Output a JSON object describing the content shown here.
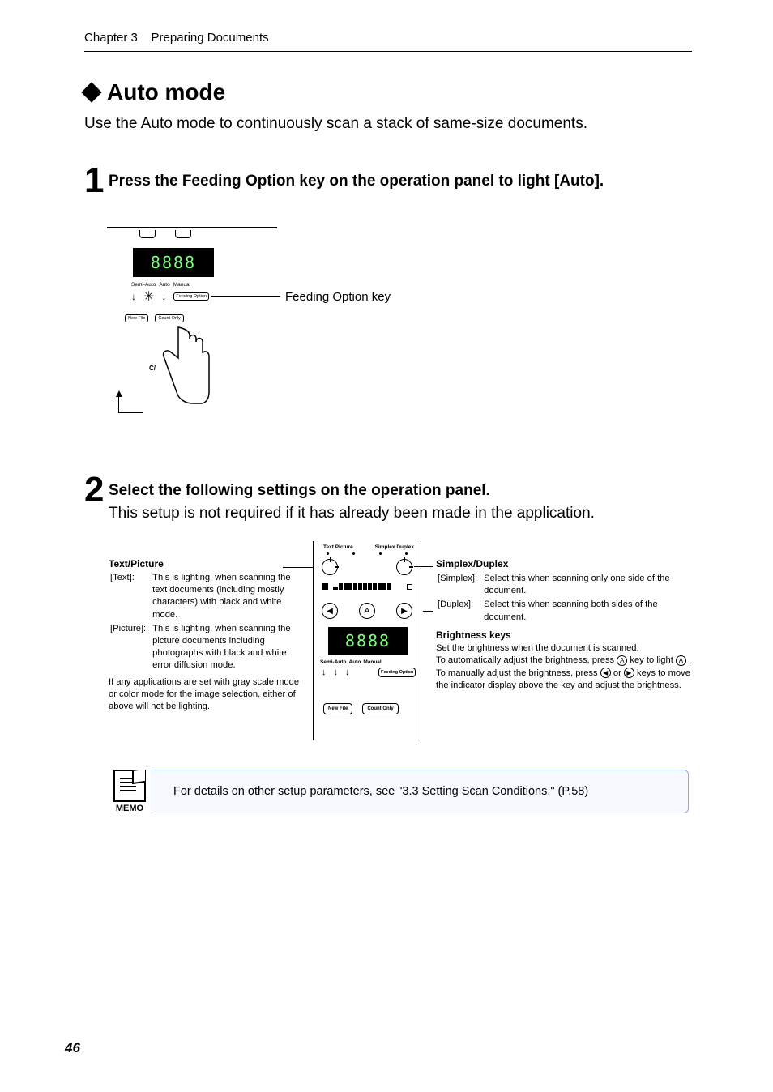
{
  "header": {
    "chapter": "Chapter 3",
    "title": "Preparing Documents"
  },
  "section": {
    "title": "Auto mode",
    "intro": "Use the Auto mode to continuously scan a stack of same-size documents."
  },
  "steps": [
    {
      "num": "1",
      "heading": "Press the Feeding Option key on the operation panel to light [Auto]."
    },
    {
      "num": "2",
      "heading": "Select the following settings on the operation panel.",
      "desc": "This setup is not required if it has already been made in the application."
    }
  ],
  "fig1": {
    "lcd": "8888",
    "mode_labels": [
      "Semi-Auto",
      "Auto",
      "Manual"
    ],
    "feeding_option_small": "Feeding Option",
    "feeding_option_label": "Feeding Option key",
    "buttons": [
      "New File",
      "Count Only"
    ]
  },
  "fig2": {
    "top_labels_left": "Text   Picture",
    "top_labels_right": "Simplex Duplex",
    "nav": {
      "left": "◀",
      "a": "A",
      "right": "▶"
    },
    "lcd": "8888",
    "sub_labels": [
      "Semi-Auto",
      "Auto",
      "Manual"
    ],
    "feeding_option": "Feeding Option",
    "buttons": [
      "New File",
      "Count Only"
    ]
  },
  "ann_left": {
    "title": "Text/Picture",
    "text_label": "[Text]:",
    "text_desc": "This is lighting, when scanning the text documents (including mostly characters) with black and white mode.",
    "pic_label": "[Picture]:",
    "pic_desc": "This is lighting, when scanning the picture documents including photographs with black and white error diffusion mode.",
    "below": "If any applications are set with gray scale mode or color mode for the image selection, either of above will not be lighting."
  },
  "ann_right": {
    "title": "Simplex/Duplex",
    "simplex_label": "[Simplex]:",
    "simplex_desc": "Select this when scanning only one side of the document.",
    "duplex_label": "[Duplex]:",
    "duplex_desc": "Select this when scanning both sides of the document.",
    "bk_title": "Brightness keys",
    "bk_line1": "Set the brightness when the document is scanned.",
    "bk_line2a": "To automatically adjust the brightness, press ",
    "bk_line2b": " key to light ",
    "bk_line2c": " .",
    "bk_line3a": "To manually adjust the brightness, press ",
    "bk_line3b": " or ",
    "bk_line3c": " keys to move the indicator display above the key and adjust the brightness.",
    "A": "A",
    "tri_l": "◀",
    "tri_r": "▶"
  },
  "memo": {
    "label": "MEMO",
    "text": "For details on other setup parameters, see \"3.3 Setting Scan Conditions.\" (P.58)"
  },
  "page_num": "46"
}
